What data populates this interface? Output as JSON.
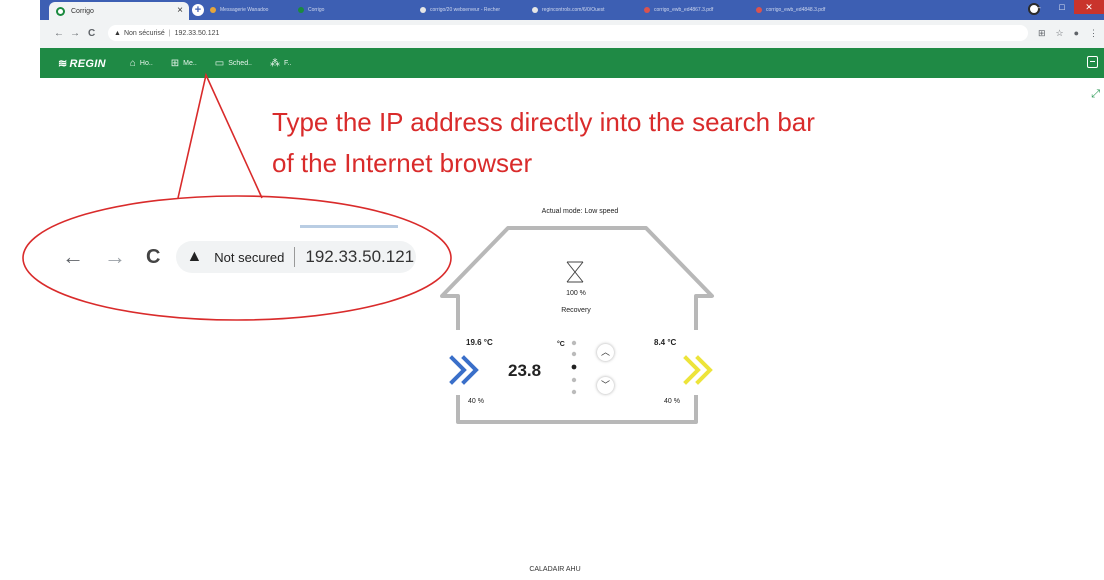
{
  "browser": {
    "active_tab_title": "Corrigo",
    "background_tabs": [
      "Messagerie Wanadoo",
      "Corrigo",
      "corrigo/20 webserveur - Recher",
      "regincontrols.com/6/0/Ouest",
      "corrigo_ewb_ed4867.3.pdf",
      "corrigo_ewb_ed4848.3.pdf"
    ],
    "security_label": "Non sécurisé",
    "url": "192.33.50.121"
  },
  "app": {
    "brand": "REGIN",
    "nav": [
      {
        "icon": "home-icon",
        "label": "Ho.."
      },
      {
        "icon": "grid-icon",
        "label": "Me.."
      },
      {
        "icon": "calendar-icon",
        "label": "Sched.."
      },
      {
        "icon": "network-icon",
        "label": "F.."
      }
    ]
  },
  "annotation": {
    "instruction_line1": "Type the IP address directly into the search bar",
    "instruction_line2": "of the Internet browser",
    "zoom_security_label": "Not secured",
    "zoom_url": "192.33.50.121",
    "color": "#d92b2b"
  },
  "unit": {
    "mode": "Actual mode: Low speed",
    "recovery_percent": "100 %",
    "recovery_label": "Recovery",
    "supply_temp": "19.6 °C",
    "outdoor_temp": "8.4 °C",
    "setpoint": "23.8",
    "setpoint_unit": "°C",
    "left_fan": "40 %",
    "right_fan": "40 %",
    "supply_arrow_color": "#3a6fc9",
    "exhaust_arrow_color": "#ede43a",
    "title": "CALADAIR AHU"
  }
}
